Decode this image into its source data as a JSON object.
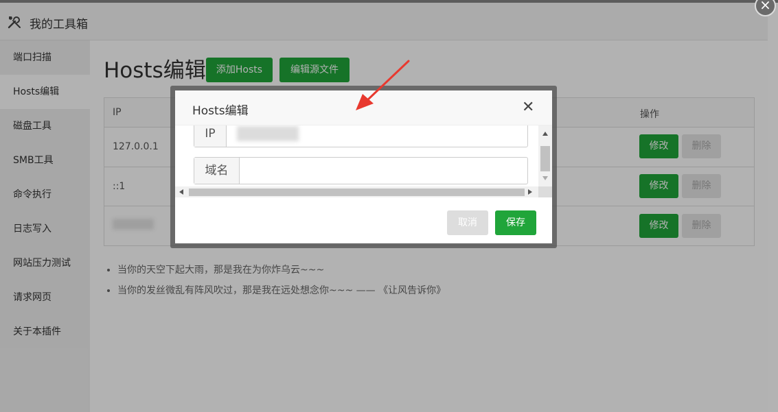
{
  "window": {
    "title": "我的工具箱",
    "close_glyph": "×"
  },
  "sidebar": {
    "items": [
      {
        "label": "端口扫描"
      },
      {
        "label": "Hosts编辑"
      },
      {
        "label": "磁盘工具"
      },
      {
        "label": "SMB工具"
      },
      {
        "label": "命令执行"
      },
      {
        "label": "日志写入"
      },
      {
        "label": "网站压力测试"
      },
      {
        "label": "请求网页"
      },
      {
        "label": "关于本插件"
      }
    ]
  },
  "main": {
    "title": "Hosts编辑",
    "add_button": "添加Hosts",
    "edit_source_button": "编辑源文件",
    "table": {
      "col_ip": "IP",
      "col_actions": "操作",
      "rows": [
        {
          "ip": "127.0.0.1",
          "edit": "修改",
          "delete": "删除"
        },
        {
          "ip": "::1",
          "edit": "修改",
          "delete": "删除"
        },
        {
          "ip": "",
          "edit": "修改",
          "delete": "删除"
        }
      ]
    },
    "notes": [
      "当你的天空下起大雨，那是我在为你炸乌云~~~",
      "当你的发丝微乱有阵风吹过，那是我在远处想念你~~~ —— 《让风告诉你》"
    ]
  },
  "modal": {
    "title": "Hosts编辑",
    "close_glyph": "✕",
    "ip_label": "IP",
    "ip_value": "",
    "domain_label": "域名",
    "domain_value": "",
    "cancel": "取消",
    "save": "保存"
  },
  "colors": {
    "accent": "#20a53a",
    "overlay": "rgba(0,0,0,0.3)",
    "annotation": "#e8392f"
  },
  "icons": {
    "window_title": "tools-icon",
    "modal_close": "close-icon"
  }
}
